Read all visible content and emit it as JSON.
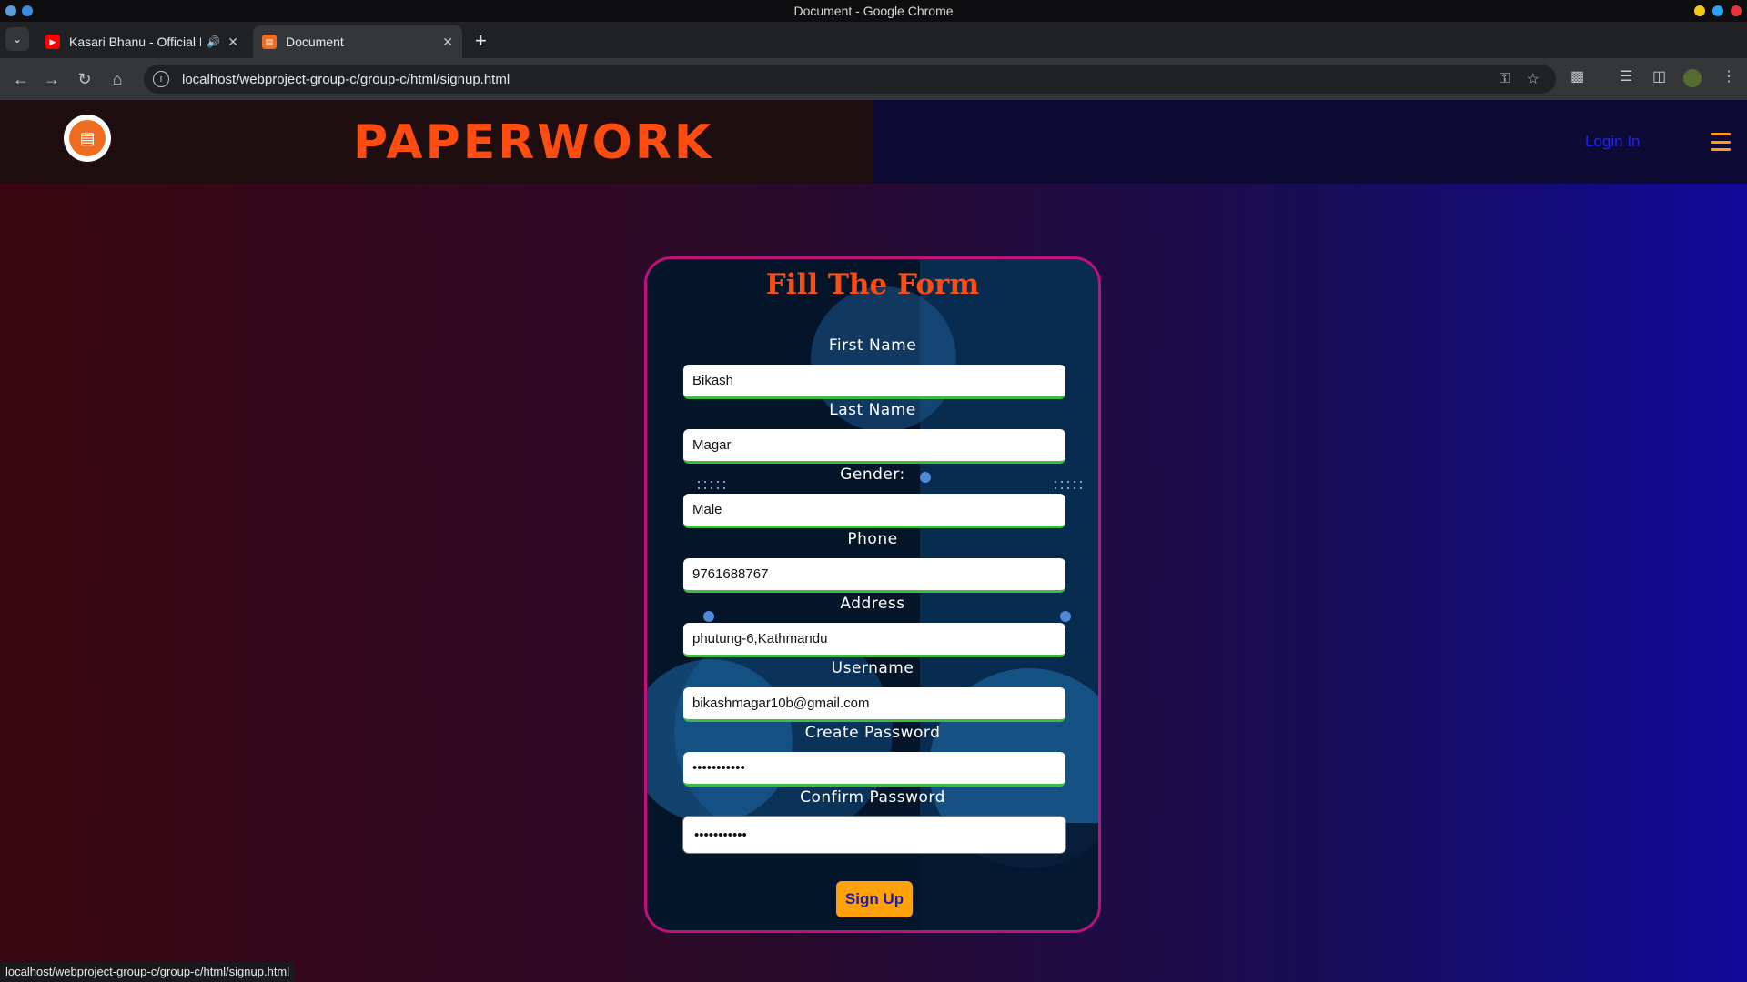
{
  "window": {
    "title": "Document - Google Chrome"
  },
  "tabs": [
    {
      "label": "Kasari Bhanu - Official L",
      "icon": "youtube-icon"
    },
    {
      "label": "Document",
      "icon": "document-favicon"
    }
  ],
  "toolbar": {
    "url": "localhost/webproject-group-c/group-c/html/signup.html"
  },
  "site": {
    "brand": "PAPERWORK",
    "login_link": "Login In"
  },
  "form": {
    "title": "Fill The Form",
    "fields": [
      {
        "label": "First Name",
        "value": "Bikash"
      },
      {
        "label": "Last Name",
        "value": "Magar"
      },
      {
        "label": "Gender:",
        "value": "Male"
      },
      {
        "label": "Phone",
        "value": "9761688767"
      },
      {
        "label": "Address",
        "value": "phutung-6,Kathmandu"
      },
      {
        "label": "Username",
        "value": "bikashmagar10b@gmail.com"
      },
      {
        "label": "Create Password",
        "value": "•••••••••••"
      },
      {
        "label": "Confirm Password",
        "value": "•••••••••••"
      }
    ],
    "submit_label": "Sign Up"
  },
  "status_bar": {
    "text": "localhost/webproject-group-c/group-c/html/signup.html"
  },
  "colors": {
    "brand": "#ff4d12",
    "card_border": "#c0117a",
    "button": "#ffa10a",
    "input_underline": "#3dbb43",
    "login_link": "#1f25e8"
  }
}
